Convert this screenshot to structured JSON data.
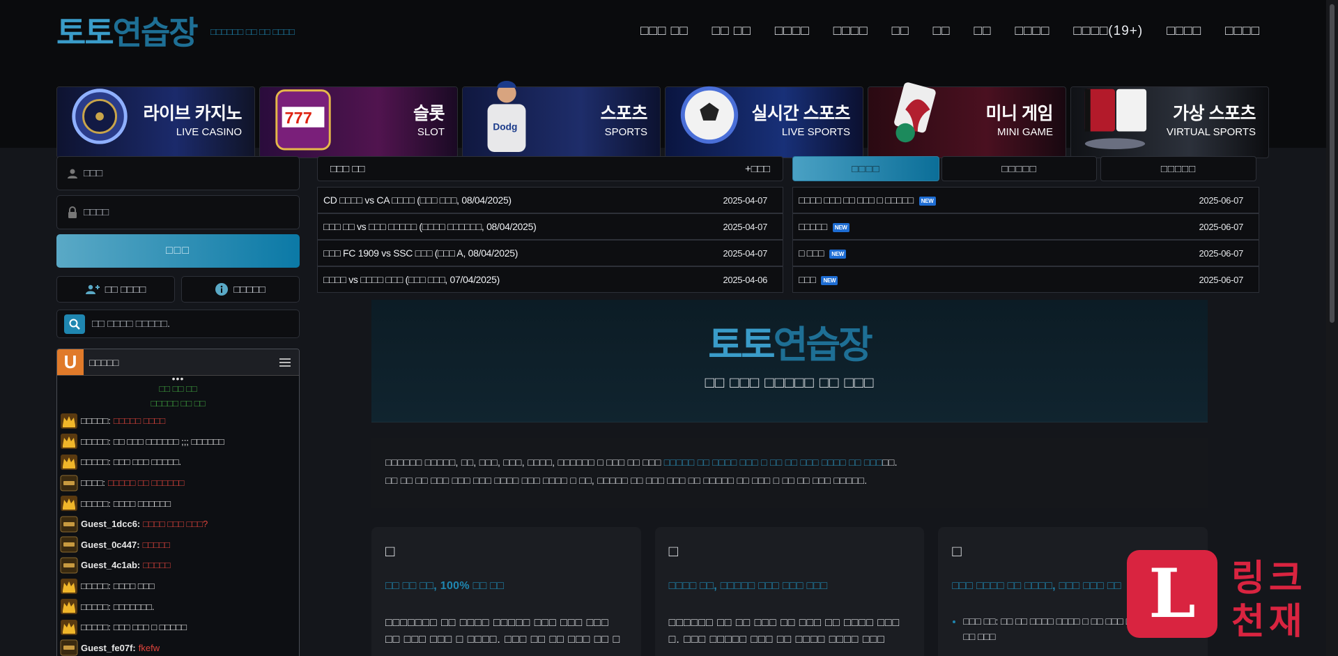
{
  "header": {
    "logo_part1": "토토",
    "logo_part2": "연습장",
    "logo_subtitle": "□□□□□□ □□ □□ □□□□",
    "nav": [
      "□□□ □□",
      "□□ □□",
      "□□□□",
      "□□□□",
      "□□",
      "□□",
      "□□",
      "□□□□",
      "□□□□(19+)",
      "□□□□",
      "□□□□"
    ]
  },
  "banners": [
    {
      "ko": "라이브 카지노",
      "en": "LIVE CASINO",
      "icon": "roulette-icon"
    },
    {
      "ko": "슬롯",
      "en": "SLOT",
      "icon": "slot-machine-icon"
    },
    {
      "ko": "스포츠",
      "en": "SPORTS",
      "icon": "baseball-player-icon"
    },
    {
      "ko": "실시간 스포츠",
      "en": "LIVE SPORTS",
      "icon": "soccer-ball-icon"
    },
    {
      "ko": "미니 게임",
      "en": "MINI GAME",
      "icon": "cards-icon"
    },
    {
      "ko": "가상 스포츠",
      "en": "VIRTUAL SPORTS",
      "icon": "jerseys-icon"
    }
  ],
  "login": {
    "id_placeholder": "□□□",
    "pw_placeholder": "□□□□",
    "login_label": "□□□",
    "signup_label": "□□ □□□□",
    "help_label": "□□□□□",
    "search_placeholder": "□□ □□□□ □□□□□."
  },
  "chat": {
    "title": "□□□□□",
    "dots": "•••",
    "notice1": "□□ □□ □□",
    "notice2": "□□□□□ □□ □□",
    "messages": [
      {
        "name": "□□□□□:",
        "text": "□□□□□ □□□□",
        "red": true,
        "badge": "crown"
      },
      {
        "name": "□□□□□:",
        "text": "□□ □□□ □□□□□□ ;;; □□□□□□",
        "red": false,
        "badge": "crown"
      },
      {
        "name": "□□□□□:",
        "text": "□□□ □□□ □□□□□.",
        "red": false,
        "badge": "crown"
      },
      {
        "name": "□□□□:",
        "text": "□□□□□ □□ □□□□□□",
        "red": true,
        "badge": "bronze"
      },
      {
        "name": "□□□□□:",
        "text": "□□□□ □□□□□□",
        "red": false,
        "badge": "crown"
      },
      {
        "name": "Guest_1dcc6:",
        "text": "□□□□ □□□ □□□?",
        "red": true,
        "badge": "bronze",
        "guest": true
      },
      {
        "name": "Guest_0c447:",
        "text": "□□□□□",
        "red": true,
        "badge": "bronze",
        "guest": true
      },
      {
        "name": "Guest_4c1ab:",
        "text": "□□□□□",
        "red": true,
        "badge": "bronze",
        "guest": true
      },
      {
        "name": "□□□□□:",
        "text": "□□□□ □□□",
        "red": false,
        "badge": "crown"
      },
      {
        "name": "□□□□□:",
        "text": "□□□□□□□.",
        "red": false,
        "badge": "crown"
      },
      {
        "name": "□□□□□:",
        "text": "□□□ □□□ □ □□□□□",
        "red": false,
        "badge": "crown"
      },
      {
        "name": "Guest_fe07f:",
        "text": "fkefw",
        "red": true,
        "badge": "bronze",
        "guest": true
      }
    ]
  },
  "match_panel": {
    "title": "□□□ □□",
    "more": "+□□□",
    "rows": [
      {
        "text": "CD □□□□ vs CA □□□□ (□□□ □□□, 08/04/2025)",
        "date": "2025-04-07"
      },
      {
        "text": "□□□ □□ vs □□□ □□□□□ (□□□□ □□□□□□, 08/04/2025)",
        "date": "2025-04-07"
      },
      {
        "text": "□□□ FC 1909 vs SSC □□□ (□□□ A, 08/04/2025)",
        "date": "2025-04-07"
      },
      {
        "text": "□□□□ vs □□□□ □□□ (□□□ □□□, 07/04/2025)",
        "date": "2025-04-06"
      }
    ]
  },
  "notice_panel": {
    "tabs": [
      "□□□□",
      "□□□□□",
      "□□□□□"
    ],
    "rows": [
      {
        "text": "□□□□ □□□ □□ □□□ □ □□□□□",
        "date": "2025-06-07"
      },
      {
        "text": "□□□□□",
        "date": "2025-06-07"
      },
      {
        "text": "□ □□□",
        "date": "2025-06-07"
      },
      {
        "text": "□□□",
        "date": "2025-06-07"
      }
    ],
    "new_badge": "NEW"
  },
  "hero": {
    "logo_part1": "토토",
    "logo_part2": "연습장",
    "tagline": "□□ □□□ □□□□□ □□ □□□"
  },
  "intro": {
    "line1_a": "□□□□□□ □□□□□, □□, □□□, □□□, □□□□, □□□□□□ □ □□□ □□ □□□ ",
    "line1_highlight": "□□□□□ □□ □□□□ □□□ □ □□ □□ □□□ □□□□ □□ □□□",
    "line1_b": "□□.",
    "line2": "□□ □□ □□ □□□ □□□ □□□ □□□□ □□□ □□□□ □ □□, □□□□□ □□ □□□ □□□ □□ □□□□□ □□ □□□ □ □□ □□ □□□ □□□□□."
  },
  "cards": [
    {
      "icon": "□",
      "title": "□□ □□ □□, 100% □□ □□",
      "body": "□□□□□□□ □□ □□□□ □□□□□ □□□ □□□ □□□ □□ □□□ □□□ □ □□□□. □□□ □□ □□ □□□ □□ □"
    },
    {
      "icon": "□",
      "title": "□□□□ □□, □□□□□ □□□ □□□ □□□",
      "body": "□□□□□□ □□ □□ □□□ □□ □□□ □□ □□□□ □□□ □. □□□ □□□□□ □□□ □□ □□□□ □□□□ □□□"
    },
    {
      "icon": "□",
      "title": "□□□ □□□□ □□ □□□□, □□□ □□□ □□",
      "bullet": "□□□ □□: □□ □□ □□□□ □□□□ □ □□ □□□ □ □□, □□□ □□□ □□ □□□"
    }
  ],
  "watermark": {
    "letter": "L",
    "line1": "링크",
    "line2": "천재"
  }
}
